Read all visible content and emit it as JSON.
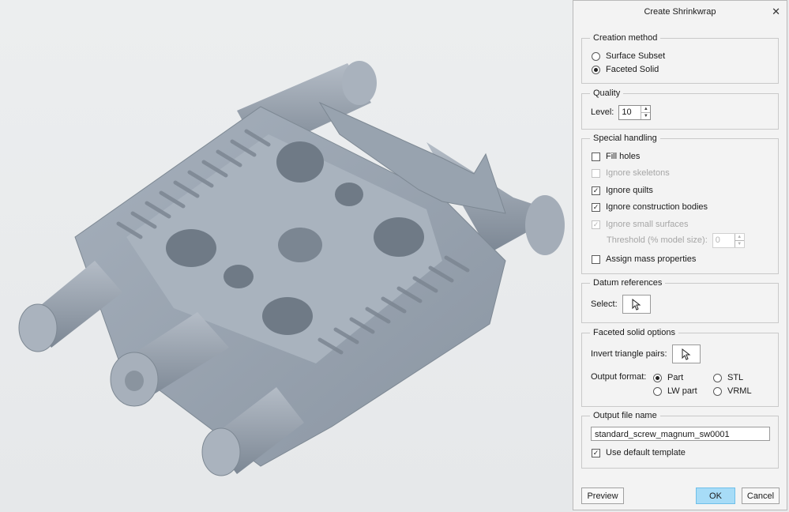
{
  "dialog": {
    "title": "Create Shrinkwrap",
    "creation_method": {
      "label": "Creation method",
      "options": [
        "Surface Subset",
        "Faceted Solid"
      ],
      "selected": "Faceted Solid"
    },
    "quality": {
      "label": "Quality",
      "level_label": "Level:",
      "level_value": "10"
    },
    "special_handling": {
      "label": "Special handling",
      "fill_holes": "Fill holes",
      "ignore_skeletons": "Ignore skeletons",
      "ignore_quilts": "Ignore quilts",
      "ignore_construction_bodies": "Ignore construction bodies",
      "ignore_small_surfaces": "Ignore small surfaces",
      "threshold_label": "Threshold (% model size):",
      "threshold_value": "0",
      "assign_mass": "Assign mass properties"
    },
    "datum_references": {
      "label": "Datum references",
      "select_label": "Select:"
    },
    "faceted_solid_options": {
      "label": "Faceted solid options",
      "invert_label": "Invert triangle pairs:",
      "output_format_label": "Output format:",
      "formats": [
        "Part",
        "STL",
        "LW part",
        "VRML"
      ],
      "selected_format": "Part"
    },
    "output_file": {
      "label": "Output file name",
      "file_name": "standard_screw_magnum_sw0001",
      "use_default_template": "Use default template"
    },
    "buttons": {
      "preview": "Preview",
      "ok": "OK",
      "cancel": "Cancel"
    },
    "check_mark": "✓"
  },
  "colors": {
    "model": "#9ea8b4",
    "accent": "#a7dcf7",
    "dialog_bg": "#f3f3f3"
  }
}
